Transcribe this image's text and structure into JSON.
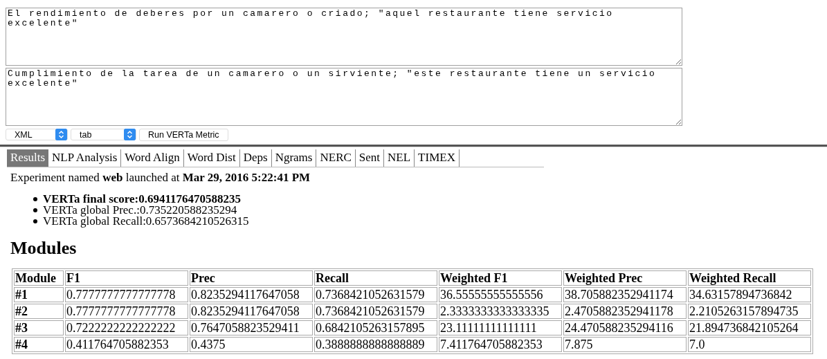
{
  "inputs": [
    {
      "value": "El rendimiento de deberes por un camarero o criado; \"aquel restaurante tiene servicio excelente\""
    },
    {
      "value": "Cumplimiento de la tarea de un camarero o un sirviente; \"este restaurante tiene un servicio excelente\""
    }
  ],
  "selects": [
    {
      "value": "XML"
    },
    {
      "value": "tab"
    }
  ],
  "run_button": "Run VERTa Metric",
  "tabs": [
    {
      "label": "Results",
      "selected": true
    },
    {
      "label": "NLP Analysis",
      "selected": false
    },
    {
      "label": "Word Align",
      "selected": false
    },
    {
      "label": "Word Dist",
      "selected": false
    },
    {
      "label": "Deps",
      "selected": false
    },
    {
      "label": "Ngrams",
      "selected": false
    },
    {
      "label": "NERC",
      "selected": false
    },
    {
      "label": "Sent",
      "selected": false
    },
    {
      "label": "NEL",
      "selected": false
    },
    {
      "label": "TIMEX",
      "selected": false
    }
  ],
  "summary": "Experiment named **web** launched at **Mar 29, 2016 5:22:41 PM**",
  "scores": [
    {
      "text": "VERTa final score:0.6941176470588235",
      "bold": true
    },
    {
      "text": "VERTa global Prec.:0.735220588235294",
      "bold": false
    },
    {
      "text": "VERTa global Recall:0.6573684210526315",
      "bold": false
    }
  ],
  "heading": "Modules",
  "table": {
    "columns": [
      "Module",
      "F1",
      "Prec",
      "Recall",
      "Weighted F1",
      "Weighted Prec",
      "Weighted Recall"
    ],
    "rows": [
      [
        "#1",
        "0.7777777777777778",
        "0.8235294117647058",
        "0.7368421052631579",
        "36.55555555555556",
        "38.705882352941174",
        "34.63157894736842"
      ],
      [
        "#2",
        "0.7777777777777778",
        "0.8235294117647058",
        "0.7368421052631579",
        "2.3333333333333335",
        "2.4705882352941178",
        "2.2105263157894735"
      ],
      [
        "#3",
        "0.7222222222222222",
        "0.7647058823529411",
        "0.6842105263157895",
        "23.11111111111111",
        "24.470588235294116",
        "21.894736842105264"
      ],
      [
        "#4",
        "0.411764705882353",
        "0.4375",
        "0.3888888888888889",
        "7.411764705882353",
        "7.875",
        "7.0"
      ]
    ]
  }
}
